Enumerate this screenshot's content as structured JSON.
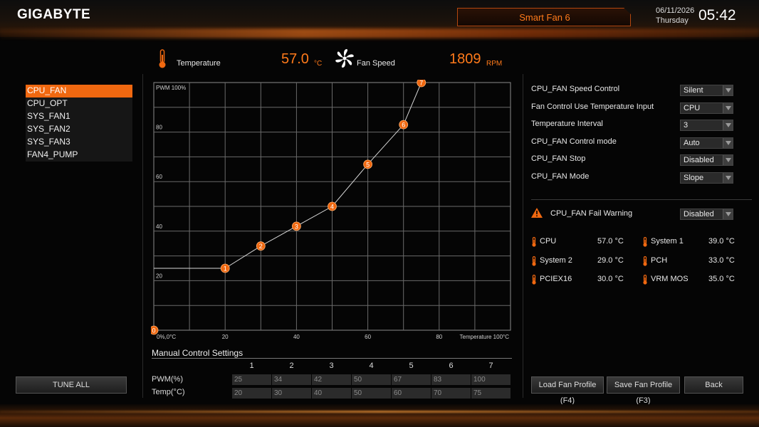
{
  "header": {
    "logo": "GIGABYTE",
    "title": "Smart Fan 6",
    "date": "06/11/2026",
    "day": "Thursday",
    "time": "05:42"
  },
  "readout": {
    "temperature_label": "Temperature",
    "temperature_value": "57.0",
    "temperature_unit": "°C",
    "fan_speed_label": "Fan Speed",
    "fan_speed_value": "1809",
    "fan_speed_unit": "RPM"
  },
  "fans": [
    "CPU_FAN",
    "CPU_OPT",
    "SYS_FAN1",
    "SYS_FAN2",
    "SYS_FAN3",
    "FAN4_PUMP"
  ],
  "active_fan": "CPU_FAN",
  "tune_all_label": "TUNE ALL",
  "chart_data": {
    "type": "line",
    "x": [
      0,
      20,
      30,
      40,
      50,
      60,
      70,
      75
    ],
    "y": [
      0,
      25,
      34,
      42,
      50,
      67,
      83,
      100
    ],
    "point_labels": [
      "0",
      "1",
      "2",
      "3",
      "4",
      "5",
      "6",
      "7"
    ],
    "xlim": [
      0,
      100
    ],
    "ylim": [
      0,
      100
    ],
    "x_ticks": [
      "20",
      "40",
      "60",
      "80"
    ],
    "y_ticks": [
      "20",
      "40",
      "60",
      "80"
    ],
    "origin_label": "0%,0°C",
    "xlabel": "Temperature 100°C",
    "ylabel": "PWM 100%",
    "grid": true,
    "color": "#f06810"
  },
  "manual": {
    "title": "Manual Control Settings",
    "columns": [
      "1",
      "2",
      "3",
      "4",
      "5",
      "6",
      "7"
    ],
    "pwm_label": "PWM(%)",
    "pwm": [
      "25",
      "34",
      "42",
      "50",
      "67",
      "83",
      "100"
    ],
    "temp_label": "Temp(°C)",
    "temp": [
      "20",
      "30",
      "40",
      "50",
      "60",
      "70",
      "75"
    ]
  },
  "settings": [
    {
      "label": "CPU_FAN Speed Control",
      "value": "Silent"
    },
    {
      "label": "Fan Control Use Temperature Input",
      "value": "CPU"
    },
    {
      "label": "Temperature Interval",
      "value": "3"
    },
    {
      "label": "CPU_FAN Control mode",
      "value": "Auto"
    },
    {
      "label": "CPU_FAN Stop",
      "value": "Disabled"
    },
    {
      "label": "CPU_FAN Mode",
      "value": "Slope"
    }
  ],
  "fail_warning": {
    "label": "CPU_FAN Fail Warning",
    "value": "Disabled"
  },
  "temps": [
    {
      "name": "CPU",
      "value": "57.0 °C"
    },
    {
      "name": "System 1",
      "value": "39.0 °C"
    },
    {
      "name": "System 2",
      "value": "29.0 °C"
    },
    {
      "name": "PCH",
      "value": "33.0 °C"
    },
    {
      "name": "PCIEX16",
      "value": "30.0 °C"
    },
    {
      "name": "VRM MOS",
      "value": "35.0 °C"
    }
  ],
  "buttons": {
    "load": "Load Fan Profile (F4)",
    "save": "Save Fan Profile (F3)",
    "back": "Back"
  },
  "colors": {
    "accent": "#f06810",
    "warning": "#f06810"
  }
}
